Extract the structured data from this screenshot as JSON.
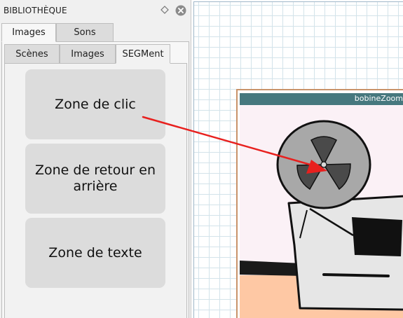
{
  "library": {
    "title": "BIBLIOTHÈQUE",
    "pin_icon": "diamond-pin-icon",
    "close_icon": "close-circle-icon",
    "main_tabs": [
      {
        "label": "Images",
        "active": true
      },
      {
        "label": "Sons",
        "active": false
      }
    ],
    "sub_tabs": [
      {
        "label": "Scènes",
        "active": false
      },
      {
        "label": "Images",
        "active": false
      },
      {
        "label": "SEGMent",
        "active": true
      }
    ],
    "segment_items": [
      {
        "label": "Zone de clic"
      },
      {
        "label": "Zone de retour en arrière"
      },
      {
        "label": "Zone de texte"
      }
    ]
  },
  "canvas": {
    "scene": {
      "title": "bobineZoom",
      "image": "film-reel-projector-drawing"
    }
  },
  "colors": {
    "panel_bg": "#f0f0f0",
    "button_bg": "#dcdcdc",
    "scene_header": "#46787e",
    "scene_border": "#c9936a",
    "arrow": "#e8201e",
    "grid": "#d3e3ea"
  }
}
